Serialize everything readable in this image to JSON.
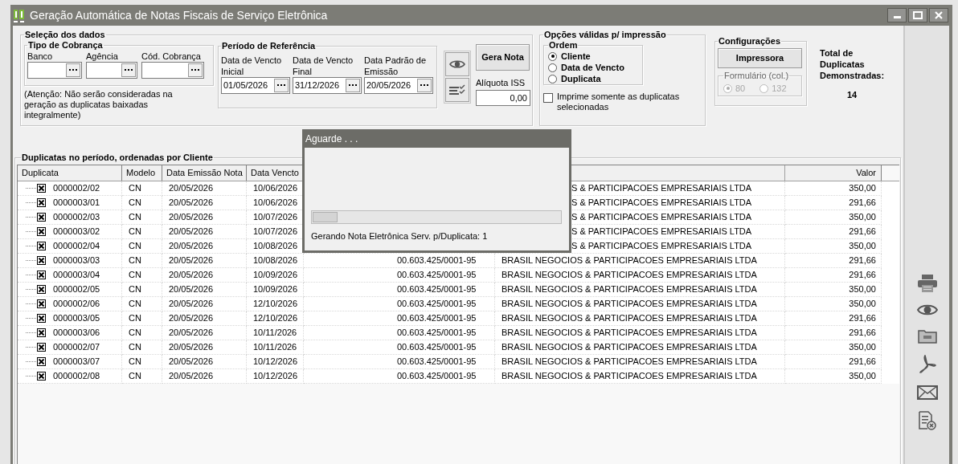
{
  "window": {
    "title": "Geração Automática de Notas Fiscais de Serviço Eletrônica"
  },
  "selection": {
    "title": "Seleção dos dados",
    "billing_type": {
      "title": "Tipo de Cobrança",
      "fields": [
        {
          "label": "Banco"
        },
        {
          "label": "Agência"
        },
        {
          "label": "Cód. Cobrança"
        }
      ]
    },
    "note": "(Atenção: Não serão consideradas na geração as duplicatas baixadas integralmente)",
    "period": {
      "title": "Período de Referência",
      "fields": [
        {
          "label": "Data de Vencto Inicial",
          "value": "01/05/2026"
        },
        {
          "label": "Data de Vencto Final",
          "value": "31/12/2026"
        },
        {
          "label": "Data Padrão de Emissão",
          "value": "20/05/2026"
        }
      ]
    },
    "generate_button": "Gera Nota",
    "iss": {
      "label": "Alíquota ISS",
      "value": "0,00"
    }
  },
  "print_options": {
    "title": "Opções válidas p/ impressão",
    "order": {
      "title": "Ordem",
      "options": [
        {
          "label": "Cliente",
          "selected": true
        },
        {
          "label": "Data de Vencto",
          "selected": false
        },
        {
          "label": "Duplicata",
          "selected": false
        }
      ]
    },
    "only_selected": {
      "label": "Imprime somente as duplicatas selecionadas",
      "checked": false
    }
  },
  "settings": {
    "title": "Configurações",
    "printer_button": "Impressora",
    "form": {
      "title": "Formulário (col.)",
      "disabled": true,
      "options": [
        {
          "label": "80",
          "selected": true
        },
        {
          "label": "132",
          "selected": false
        }
      ]
    }
  },
  "total": {
    "label": "Total de Duplicatas Demonstradas:",
    "value": "14"
  },
  "list": {
    "title": "Duplicatas no período, ordenadas por Cliente",
    "columns": [
      {
        "label": "Duplicata"
      },
      {
        "label": "Modelo"
      },
      {
        "label": "Data Emissão Nota"
      },
      {
        "label": "Data Vencto"
      },
      {
        "label": "Valor"
      }
    ],
    "rows": [
      {
        "duplicata": "0000002/02",
        "model": "CN",
        "issue_date": "20/05/2026",
        "due_date": "10/06/2026",
        "client": "S & PARTICIPACOES EMPRESARIAIS LTDA",
        "value": "350,00",
        "checked": true
      },
      {
        "duplicata": "0000003/01",
        "model": "CN",
        "issue_date": "20/05/2026",
        "due_date": "10/06/2026",
        "client": "S & PARTICIPACOES EMPRESARIAIS LTDA",
        "value": "291,66",
        "checked": true
      },
      {
        "duplicata": "0000002/03",
        "model": "CN",
        "issue_date": "20/05/2026",
        "due_date": "10/07/2026",
        "client": "S & PARTICIPACOES EMPRESARIAIS LTDA",
        "value": "350,00",
        "checked": true
      },
      {
        "duplicata": "0000003/02",
        "model": "CN",
        "issue_date": "20/05/2026",
        "due_date": "10/07/2026",
        "client": "S & PARTICIPACOES EMPRESARIAIS LTDA",
        "value": "291,66",
        "checked": true
      },
      {
        "duplicata": "0000002/04",
        "model": "CN",
        "issue_date": "20/05/2026",
        "due_date": "10/08/2026",
        "client": "S & PARTICIPACOES EMPRESARIAIS LTDA",
        "value": "350,00",
        "checked": true
      },
      {
        "duplicata": "0000003/03",
        "model": "CN",
        "issue_date": "20/05/2026",
        "due_date": "10/08/2026",
        "cnpj": "00.603.425/0001-95",
        "client": "BRASIL NEGOCIOS & PARTICIPACOES EMPRESARIAIS LTDA",
        "value": "291,66",
        "checked": true
      },
      {
        "duplicata": "0000003/04",
        "model": "CN",
        "issue_date": "20/05/2026",
        "due_date": "10/09/2026",
        "cnpj": "00.603.425/0001-95",
        "client": "BRASIL NEGOCIOS & PARTICIPACOES EMPRESARIAIS LTDA",
        "value": "291,66",
        "checked": true
      },
      {
        "duplicata": "0000002/05",
        "model": "CN",
        "issue_date": "20/05/2026",
        "due_date": "10/09/2026",
        "cnpj": "00.603.425/0001-95",
        "client": "BRASIL NEGOCIOS & PARTICIPACOES EMPRESARIAIS LTDA",
        "value": "350,00",
        "checked": true
      },
      {
        "duplicata": "0000002/06",
        "model": "CN",
        "issue_date": "20/05/2026",
        "due_date": "12/10/2026",
        "cnpj": "00.603.425/0001-95",
        "client": "BRASIL NEGOCIOS & PARTICIPACOES EMPRESARIAIS LTDA",
        "value": "350,00",
        "checked": true
      },
      {
        "duplicata": "0000003/05",
        "model": "CN",
        "issue_date": "20/05/2026",
        "due_date": "12/10/2026",
        "cnpj": "00.603.425/0001-95",
        "client": "BRASIL NEGOCIOS & PARTICIPACOES EMPRESARIAIS LTDA",
        "value": "291,66",
        "checked": true
      },
      {
        "duplicata": "0000003/06",
        "model": "CN",
        "issue_date": "20/05/2026",
        "due_date": "10/11/2026",
        "cnpj": "00.603.425/0001-95",
        "client": "BRASIL NEGOCIOS & PARTICIPACOES EMPRESARIAIS LTDA",
        "value": "291,66",
        "checked": true
      },
      {
        "duplicata": "0000002/07",
        "model": "CN",
        "issue_date": "20/05/2026",
        "due_date": "10/11/2026",
        "cnpj": "00.603.425/0001-95",
        "client": "BRASIL NEGOCIOS & PARTICIPACOES EMPRESARIAIS LTDA",
        "value": "350,00",
        "checked": true
      },
      {
        "duplicata": "0000003/07",
        "model": "CN",
        "issue_date": "20/05/2026",
        "due_date": "10/12/2026",
        "cnpj": "00.603.425/0001-95",
        "client": "BRASIL NEGOCIOS & PARTICIPACOES EMPRESARIAIS LTDA",
        "value": "291,66",
        "checked": true
      },
      {
        "duplicata": "0000002/08",
        "model": "CN",
        "issue_date": "20/05/2026",
        "due_date": "10/12/2026",
        "cnpj": "00.603.425/0001-95",
        "client": "BRASIL NEGOCIOS & PARTICIPACOES EMPRESARIAIS LTDA",
        "value": "350,00",
        "checked": true
      }
    ]
  },
  "dialog": {
    "title": "Aguarde . . .",
    "progress": {
      "level": 0.1
    },
    "message": "Gerando Nota Eletrônica Serv. p/Duplicata: 1"
  }
}
